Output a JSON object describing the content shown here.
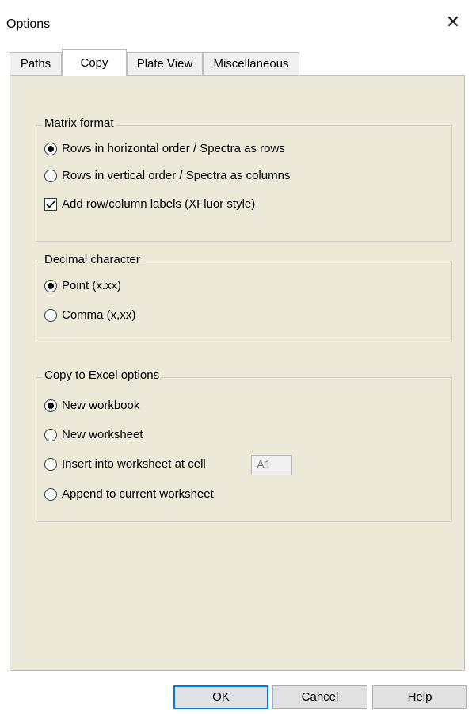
{
  "window": {
    "title": "Options",
    "close_glyph": "✕"
  },
  "tabs": [
    {
      "label": "Paths"
    },
    {
      "label": "Copy"
    },
    {
      "label": "Plate View"
    },
    {
      "label": "Miscellaneous"
    }
  ],
  "active_tab": "Copy",
  "matrix_format": {
    "title": "Matrix format",
    "options": [
      {
        "label": "Rows in horizontal order / Spectra as rows",
        "checked": true
      },
      {
        "label": "Rows in vertical order / Spectra as columns",
        "checked": false
      }
    ],
    "labels_checkbox": {
      "label": "Add row/column labels (XFluor style)",
      "checked": true
    }
  },
  "decimal_character": {
    "title": "Decimal character",
    "options": [
      {
        "label": "Point (x.xx)",
        "checked": true
      },
      {
        "label": "Comma (x,xx)",
        "checked": false
      }
    ]
  },
  "excel_options": {
    "title": "Copy to Excel options",
    "options": [
      {
        "label": "New workbook",
        "checked": true
      },
      {
        "label": "New worksheet",
        "checked": false
      },
      {
        "label": "Insert into worksheet at cell",
        "checked": false
      },
      {
        "label": "Append to current worksheet",
        "checked": false
      }
    ],
    "cell_value": "A1"
  },
  "buttons": {
    "ok": "OK",
    "cancel": "Cancel",
    "help": "Help"
  }
}
